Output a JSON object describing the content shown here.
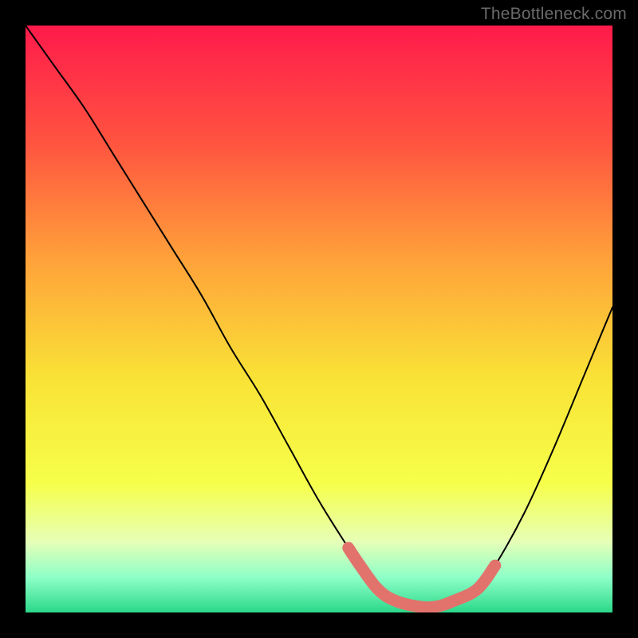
{
  "watermark": "TheBottleneck.com",
  "chart_data": {
    "type": "line",
    "title": "",
    "xlabel": "",
    "ylabel": "",
    "xlim": [
      0,
      100
    ],
    "ylim": [
      0,
      100
    ],
    "series": [
      {
        "name": "bottleneck-curve",
        "x": [
          0,
          5,
          10,
          15,
          20,
          25,
          30,
          35,
          40,
          45,
          50,
          55,
          57,
          60,
          63,
          67,
          70,
          73,
          77,
          80,
          85,
          90,
          95,
          100
        ],
        "values": [
          100,
          93,
          86,
          78,
          70,
          62,
          54,
          45,
          37,
          28,
          19,
          11,
          8,
          4,
          2,
          1,
          1,
          2,
          4,
          8,
          17,
          28,
          40,
          52
        ]
      }
    ],
    "highlight_band": {
      "name": "optimal-zone",
      "x": [
        55,
        57,
        60,
        63,
        67,
        70,
        73,
        77,
        80
      ],
      "values": [
        11,
        8,
        4,
        2,
        1,
        1,
        2,
        4,
        8
      ],
      "color": "#e2736c"
    },
    "gradient_stops": [
      {
        "offset": 0.0,
        "color": "#ff1a4b"
      },
      {
        "offset": 0.2,
        "color": "#ff5440"
      },
      {
        "offset": 0.4,
        "color": "#ffa23a"
      },
      {
        "offset": 0.6,
        "color": "#f9e236"
      },
      {
        "offset": 0.78,
        "color": "#f6ff4a"
      },
      {
        "offset": 0.88,
        "color": "#e6ffb7"
      },
      {
        "offset": 0.94,
        "color": "#8effc8"
      },
      {
        "offset": 1.0,
        "color": "#2bd88a"
      }
    ]
  }
}
